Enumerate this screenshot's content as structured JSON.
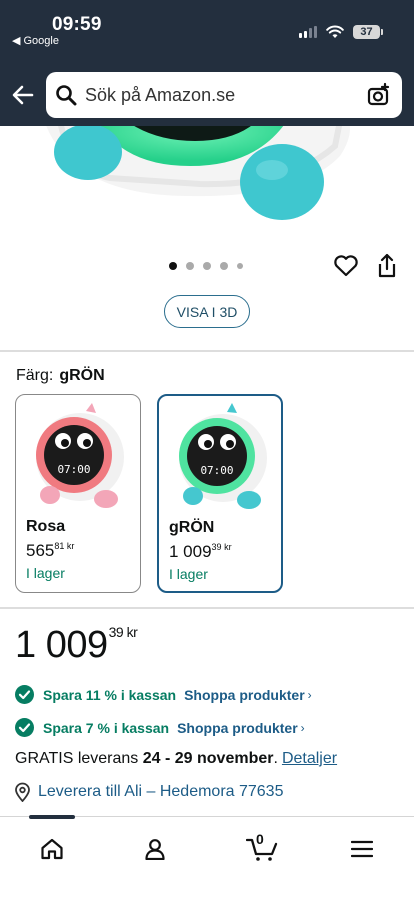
{
  "status_bar": {
    "time": "09:59",
    "back_app": "Google",
    "battery": "37"
  },
  "header": {
    "search_placeholder": "Sök på Amazon.se"
  },
  "gallery": {
    "image_count": 5,
    "active_index": 0,
    "view_3d_label": "VISA I 3D"
  },
  "variation": {
    "label": "Färg:",
    "selected_value": "gRÖN",
    "options": [
      {
        "name": "Rosa",
        "price_whole": "565",
        "price_fraction": "81",
        "currency": "kr",
        "stock": "I lager",
        "accent": "#f07a80"
      },
      {
        "name": "gRÖN",
        "price_whole": "1 009",
        "price_fraction": "39",
        "currency": "kr",
        "stock": "I lager",
        "accent": "#4fe3a0"
      }
    ]
  },
  "price": {
    "whole": "1 009",
    "fraction": "39",
    "currency": "kr"
  },
  "promotions": [
    {
      "text": "Spara 11 % i kassan",
      "link": "Shoppa produkter"
    },
    {
      "text": "Spara 7 % i kassan",
      "link": "Shoppa produkter"
    }
  ],
  "delivery": {
    "prefix": "GRATIS leverans",
    "dates": "24 - 29 november",
    "suffix": ".",
    "details_link": "Detaljer"
  },
  "location": {
    "text": "Leverera till Ali – Hedemora 77635"
  },
  "bottom_nav": {
    "cart_count": "0",
    "items": [
      "home-icon",
      "account-icon",
      "cart-icon",
      "menu-icon"
    ]
  },
  "colors": {
    "header_bg": "#232f3e",
    "link": "#1d5c87",
    "success": "#067d62",
    "selected_border": "#1d5c87"
  }
}
